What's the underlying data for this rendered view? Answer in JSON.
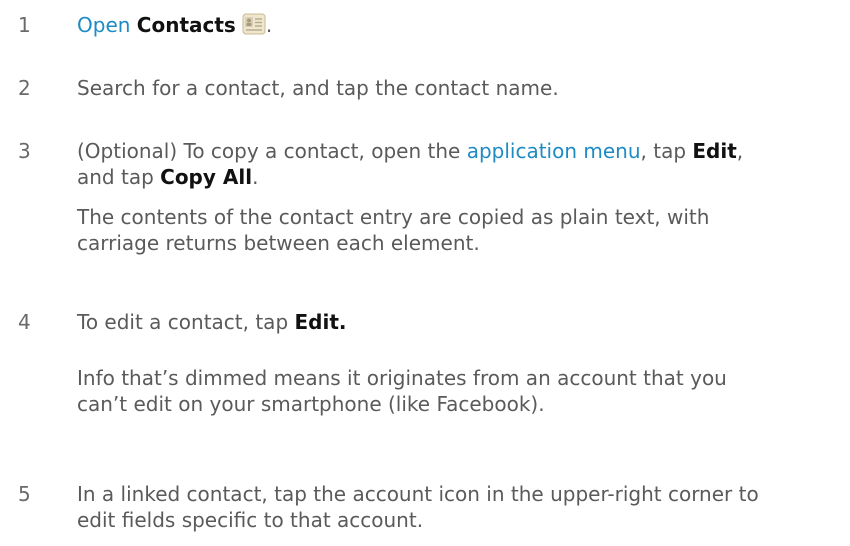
{
  "steps": [
    {
      "number": "1",
      "open_link": "Open",
      "contacts_label": "Contacts",
      "trailing": "."
    },
    {
      "number": "2",
      "text": "Search for a contact, and tap the contact name."
    },
    {
      "number": "3",
      "prefix": "(Optional) To copy a contact, open the ",
      "menu_link": "application menu",
      "mid1": ", tap ",
      "edit_label": "Edit",
      "mid2": ",",
      "line2_prefix": "and tap ",
      "copy_all_label": "Copy All",
      "line2_suffix": ".",
      "note_line1": "The contents of the contact entry are copied as plain text, with",
      "note_line2": "carriage returns between each element."
    },
    {
      "number": "4",
      "prefix": "To edit a contact, tap ",
      "edit_label": "Edit.",
      "note_line1": "Info that’s dimmed means it originates from an account that you",
      "note_line2": "can’t edit on your smartphone (like Facebook)."
    },
    {
      "number": "5",
      "line1": "In a linked contact, tap the account icon in the upper-right corner to",
      "line2": "edit fields specific to that account."
    }
  ],
  "icons": {
    "contacts": "contacts-app-icon"
  },
  "colors": {
    "text": "#5a5a5a",
    "link": "#1e8bc3",
    "bold": "#111111"
  }
}
